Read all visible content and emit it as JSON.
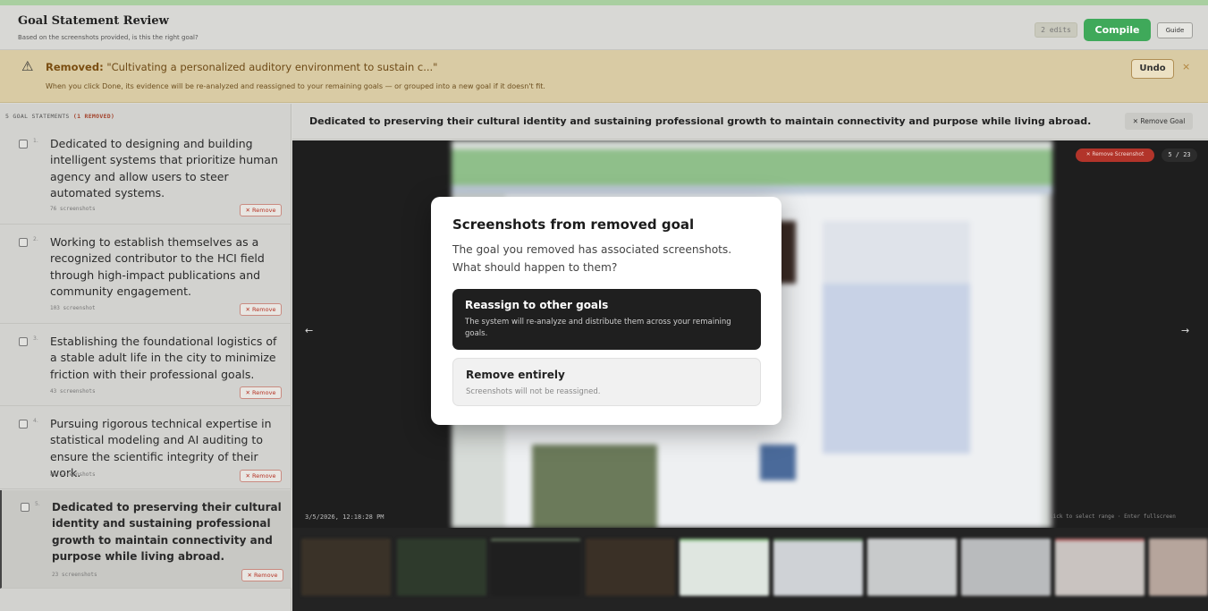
{
  "header": {
    "title": "Goal Statement Review",
    "subtitle": "Based on the screenshots provided, is this the right goal?",
    "edits": "2 edits",
    "compile": "Compile",
    "guide": "Guide"
  },
  "banner": {
    "label": "Removed:",
    "removed_text": "\"Cultivating a personalized auditory environment to sustain c...\"",
    "description": "When you click Done, its evidence will be re-analyzed and reassigned to your remaining goals — or grouped into a new goal if it doesn't fit.",
    "undo": "Undo",
    "close": "×"
  },
  "sidebar": {
    "heading_prefix": "5 GOAL STATEMENTS",
    "heading_removed": "(1 REMOVED)",
    "remove_label": "✕ Remove",
    "goals": [
      {
        "num": "1.",
        "text": "Dedicated to designing and building intelligent systems that prioritize human agency and allow users to steer automated systems.",
        "count": "76 screenshots"
      },
      {
        "num": "2.",
        "text": "Working to establish themselves as a recognized contributor to the HCI field through high-impact publications and community engagement.",
        "count": "103 screenshot"
      },
      {
        "num": "3.",
        "text": "Establishing the foundational logistics of a stable adult life in the city to minimize friction with their professional goals.",
        "count": "43 screenshots"
      },
      {
        "num": "4.",
        "text": "Pursuing rigorous technical expertise in statistical modeling and AI auditing to ensure the scientific integrity of their work.",
        "count": "89 screenshots"
      },
      {
        "num": "5.",
        "text": "Dedicated to preserving their cultural identity and sustaining professional growth to maintain connectivity and purpose while living abroad.",
        "count": "23 screenshots"
      }
    ]
  },
  "main": {
    "goal_title": "Dedicated to preserving their cultural identity and sustaining professional growth to maintain connectivity and purpose while living abroad.",
    "remove_goal": "✕ Remove Goal",
    "remove_screenshot": "✕ Remove Screenshot",
    "counter": "5 / 23",
    "prev": "←",
    "next": "→",
    "timestamp": "3/5/2026, 12:18:28 PM",
    "hint": "lick to select range · Enter fullscreen"
  },
  "modal": {
    "title": "Screenshots from removed goal",
    "description": "The goal you removed has associated screenshots. What should happen to them?",
    "options": [
      {
        "label": "Reassign to other goals",
        "sub": "The system will re-analyze and distribute them across your remaining goals."
      },
      {
        "label": "Remove entirely",
        "sub": "Screenshots will not be reassigned."
      }
    ]
  },
  "colors": {
    "accent_green": "#3fa95a",
    "warning_bg": "#d9cba4",
    "remove_red": "#b43324",
    "option_dark": "#1f1f1f"
  }
}
